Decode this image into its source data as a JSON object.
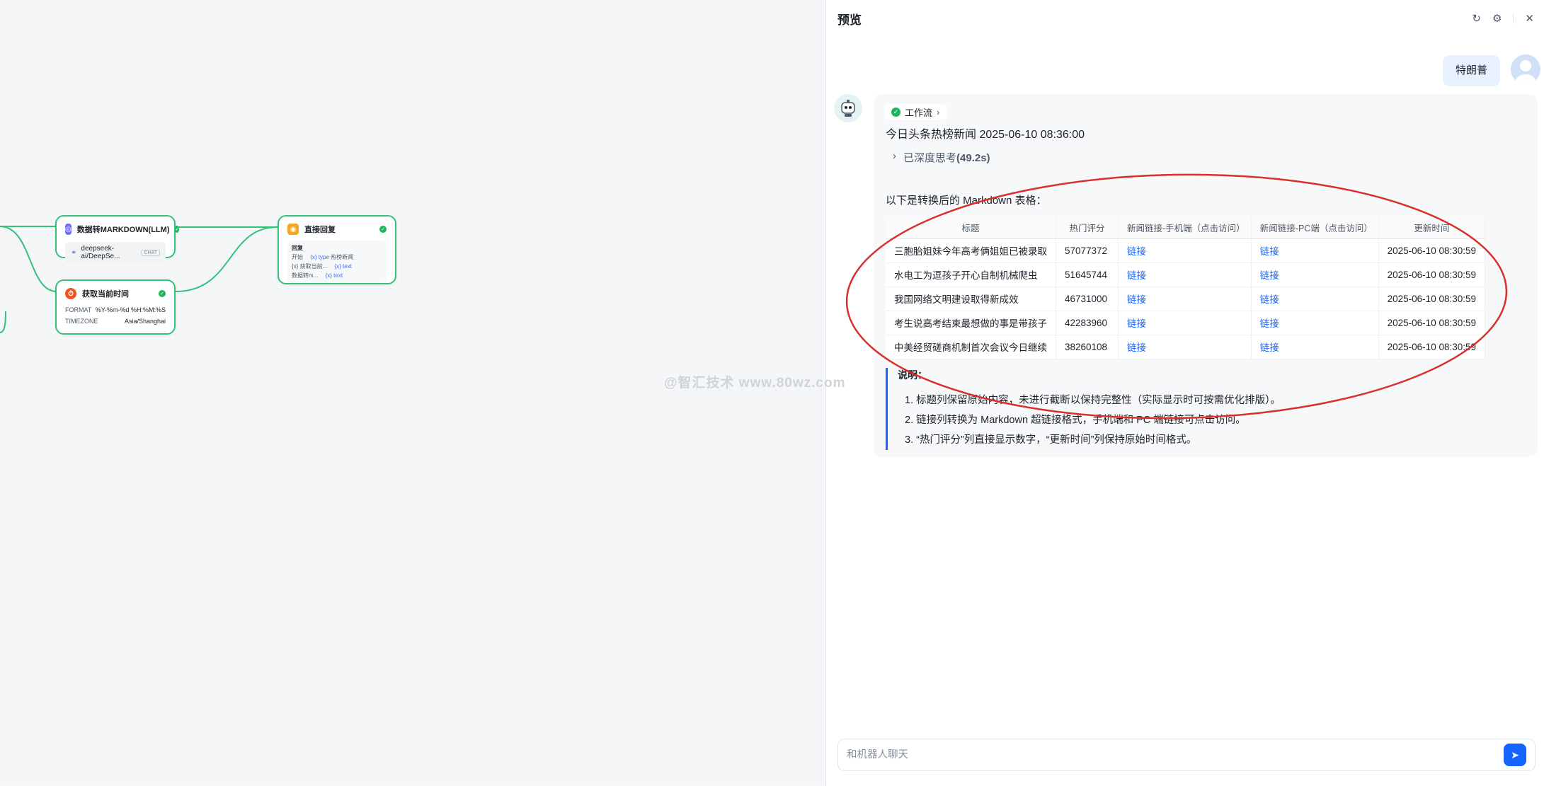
{
  "canvas": {
    "node_markdown": {
      "title": "数据转MARKDOWN(LLM)",
      "model": "deepseek-ai/DeepSe...",
      "model_tag": "CHAT"
    },
    "node_time": {
      "title": "获取当前时间",
      "rows": [
        {
          "key": "FORMAT",
          "value": "%Y-%m-%d %H:%M:%S"
        },
        {
          "key": "TIMEZONE",
          "value": "Asia/Shanghai"
        }
      ]
    },
    "node_reply": {
      "title": "直接回复",
      "label": "回复",
      "rows": [
        {
          "name": "开始",
          "var": "{x} type",
          "value": "热榜新闻"
        },
        {
          "name": "{x} 获取当前...",
          "var": "",
          "value": "{x} text"
        },
        {
          "name": "数据转m...",
          "var": "",
          "value": "{x} text"
        }
      ]
    }
  },
  "panel": {
    "title": "预览",
    "user_message": "特朗普",
    "workflow_tag": "工作流",
    "headline": "今日头条热榜新闻 2025-06-10 08:36:00",
    "think_prefix": "已深度思考",
    "think_time": "(49.2s)",
    "intro": "以下是转换后的 Markdown 表格：",
    "table": {
      "headers": [
        "标题",
        "热门评分",
        "新闻链接-手机端（点击访问）",
        "新闻链接-PC端（点击访问）",
        "更新时间"
      ],
      "rows": [
        {
          "title": "三胞胎姐妹今年高考俩姐姐已被录取",
          "score": "57077372",
          "mobile": "链接",
          "pc": "链接",
          "time": "2025-06-10 08:30:59"
        },
        {
          "title": "水电工为逗孩子开心自制机械爬虫",
          "score": "51645744",
          "mobile": "链接",
          "pc": "链接",
          "time": "2025-06-10 08:30:59"
        },
        {
          "title": "我国网络文明建设取得新成效",
          "score": "46731000",
          "mobile": "链接",
          "pc": "链接",
          "time": "2025-06-10 08:30:59"
        },
        {
          "title": "考生说高考结束最想做的事是带孩子",
          "score": "42283960",
          "mobile": "链接",
          "pc": "链接",
          "time": "2025-06-10 08:30:59"
        },
        {
          "title": "中美经贸磋商机制首次会议今日继续",
          "score": "38260108",
          "mobile": "链接",
          "pc": "链接",
          "time": "2025-06-10 08:30:59"
        }
      ]
    },
    "notes_title": "说明：",
    "notes": [
      "1. 标题列保留原始内容，未进行截断以保持完整性（实际显示时可按需优化排版）。",
      "2. 链接列转换为 Markdown 超链接格式，手机端和 PC 端链接可点击访问。",
      "3. “热门评分”列直接显示数字，“更新时间”列保持原始时间格式。"
    ],
    "input_placeholder": "和机器人聊天"
  },
  "watermark": "@智汇技术 www.80wz.com",
  "colors": {
    "accent": "#1664ff",
    "success": "#1fb55c",
    "annotation": "#d9302c"
  }
}
